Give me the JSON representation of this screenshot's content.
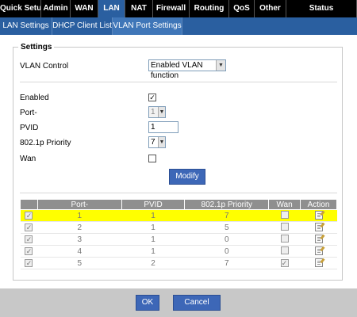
{
  "topnav": {
    "tabs": [
      {
        "label": "Quick Setup",
        "active": false
      },
      {
        "label": "Admin",
        "active": false
      },
      {
        "label": "WAN",
        "active": false
      },
      {
        "label": "LAN",
        "active": true
      },
      {
        "label": "NAT",
        "active": false
      },
      {
        "label": "Firewall",
        "active": false
      },
      {
        "label": "Routing",
        "active": false
      },
      {
        "label": "QoS",
        "active": false
      },
      {
        "label": "Other",
        "active": false
      },
      {
        "label": "Status",
        "active": false
      }
    ]
  },
  "subnav": {
    "tabs": [
      {
        "label": "LAN Settings",
        "active": false
      },
      {
        "label": "DHCP Client List",
        "active": false
      },
      {
        "label": "VLAN Port Settings",
        "active": true
      }
    ]
  },
  "settings": {
    "legend": "Settings",
    "vlan_control_label": "VLAN Control",
    "vlan_control_value": "Enabled VLAN function",
    "enabled_label": "Enabled",
    "enabled_checked": true,
    "port_label": "Port-",
    "port_value": "1",
    "pvid_label": "PVID",
    "pvid_value": "1",
    "priority_label": "802.1p Priority",
    "priority_value": "7",
    "wan_label": "Wan",
    "wan_checked": false,
    "modify_label": "Modify"
  },
  "table": {
    "headers": [
      "",
      "Port-",
      "PVID",
      "802.1p Priority",
      "Wan",
      "Action"
    ],
    "rows": [
      {
        "checked": true,
        "port": "1",
        "pvid": "1",
        "priority": "7",
        "wan": false,
        "selected": true
      },
      {
        "checked": true,
        "port": "2",
        "pvid": "1",
        "priority": "5",
        "wan": false,
        "selected": false
      },
      {
        "checked": true,
        "port": "3",
        "pvid": "1",
        "priority": "0",
        "wan": false,
        "selected": false
      },
      {
        "checked": true,
        "port": "4",
        "pvid": "1",
        "priority": "0",
        "wan": false,
        "selected": false
      },
      {
        "checked": true,
        "port": "5",
        "pvid": "2",
        "priority": "7",
        "wan": true,
        "selected": false
      }
    ]
  },
  "footer": {
    "ok_label": "OK",
    "cancel_label": "Cancel"
  },
  "colors": {
    "nav_bg": "#000000",
    "nav_active": "#2a5fa0",
    "button_bg": "#3d67b7",
    "selected_row": "#ffff00"
  }
}
